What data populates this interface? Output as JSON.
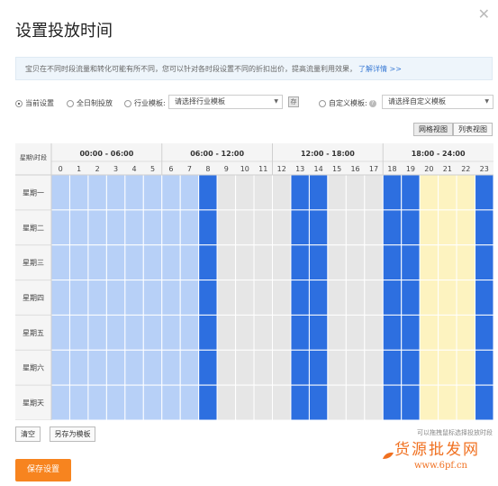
{
  "dialog": {
    "title": "设置投放时间"
  },
  "notice": {
    "text": "宝贝在不同时段流量和转化可能有所不同，您可以针对各时段设置不同的折扣出价，提高流量利用效果，",
    "link": "了解详情 >>"
  },
  "options": {
    "current": "当前设置",
    "full_day": "全日制投放",
    "industry": "行业模板:",
    "industry_select": "请选择行业模板",
    "custom": "自定义模板:",
    "custom_select": "请选择自定义模板",
    "selected": "current"
  },
  "views": {
    "grid": "网格视图",
    "list": "列表视图"
  },
  "schedule": {
    "corner": "星期\\时段",
    "ranges": [
      "00:00 - 06:00",
      "06:00 - 12:00",
      "12:00 - 18:00",
      "18:00 - 24:00"
    ],
    "hours": [
      "0",
      "1",
      "2",
      "3",
      "4",
      "5",
      "6",
      "7",
      "8",
      "9",
      "10",
      "11",
      "12",
      "13",
      "14",
      "15",
      "16",
      "17",
      "18",
      "19",
      "20",
      "21",
      "22",
      "23"
    ],
    "days": [
      "星期一",
      "星期二",
      "星期三",
      "星期四",
      "星期五",
      "星期六",
      "星期天"
    ],
    "hour_state": [
      "light",
      "light",
      "light",
      "light",
      "light",
      "light",
      "light",
      "light",
      "blue",
      "gray",
      "gray",
      "gray",
      "gray",
      "blue",
      "blue",
      "gray",
      "gray",
      "gray",
      "blue",
      "blue",
      "yellow",
      "yellow",
      "yellow",
      "blue"
    ],
    "colors": {
      "light": "#b7d0f7",
      "blue": "#2d6fe0",
      "gray": "#e6e6e6",
      "yellow": "#fdf3c0"
    }
  },
  "actions": {
    "clear": "清空",
    "save_as": "另存为模板",
    "hint": "可以拖拽鼠标选择投放时段",
    "save": "保存设置"
  },
  "watermark": {
    "text": "货源批发网",
    "url": "www.6pf.cn"
  }
}
